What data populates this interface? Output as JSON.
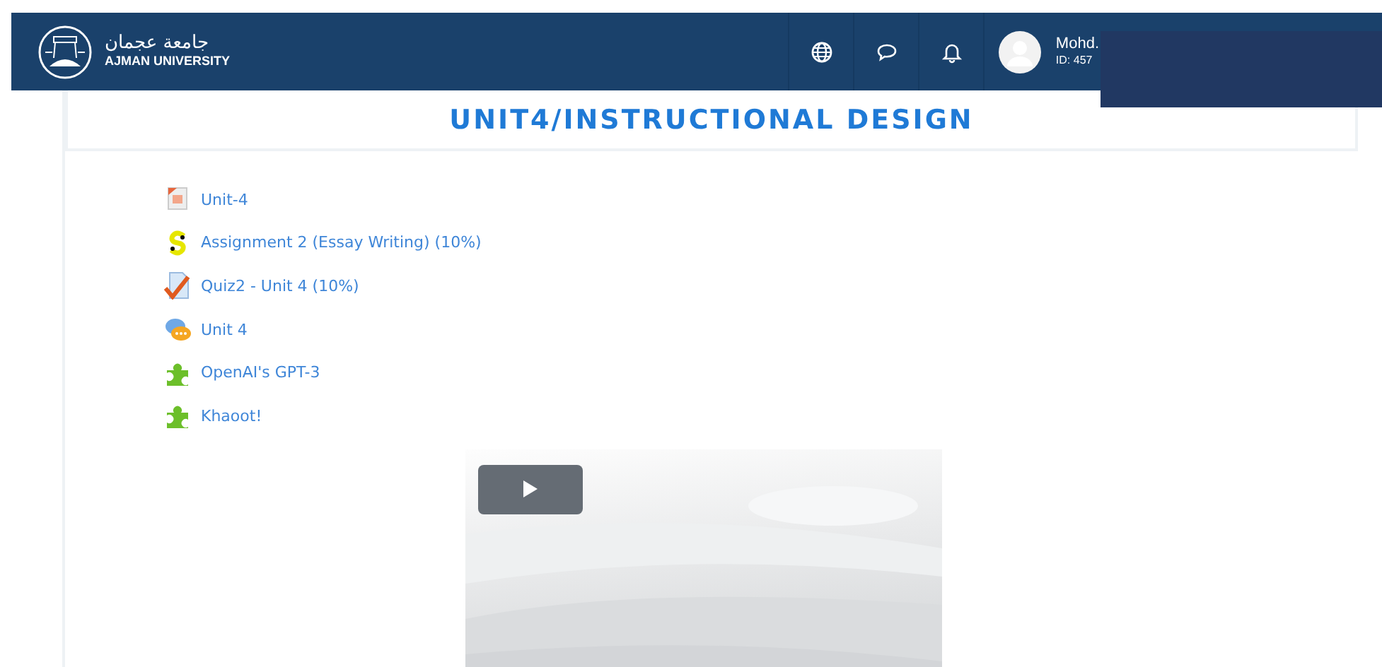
{
  "header": {
    "logo_arabic": "جامعة عجمان",
    "logo_english": "AJMAN UNIVERSITY",
    "user": {
      "name": "Mohd.",
      "id": "ID: 457"
    }
  },
  "section": {
    "title": "UNIT4/INSTRUCTIONAL DESIGN"
  },
  "activities": [
    {
      "kind": "file",
      "label": "Unit-4"
    },
    {
      "kind": "assignment",
      "label": "Assignment 2 (Essay Writing) (10%)"
    },
    {
      "kind": "quiz",
      "label": "Quiz2 - Unit 4 (10%)"
    },
    {
      "kind": "forum",
      "label": "Unit 4"
    },
    {
      "kind": "lti",
      "label": "OpenAI's GPT-3"
    },
    {
      "kind": "lti",
      "label": "Khaoot!"
    }
  ]
}
